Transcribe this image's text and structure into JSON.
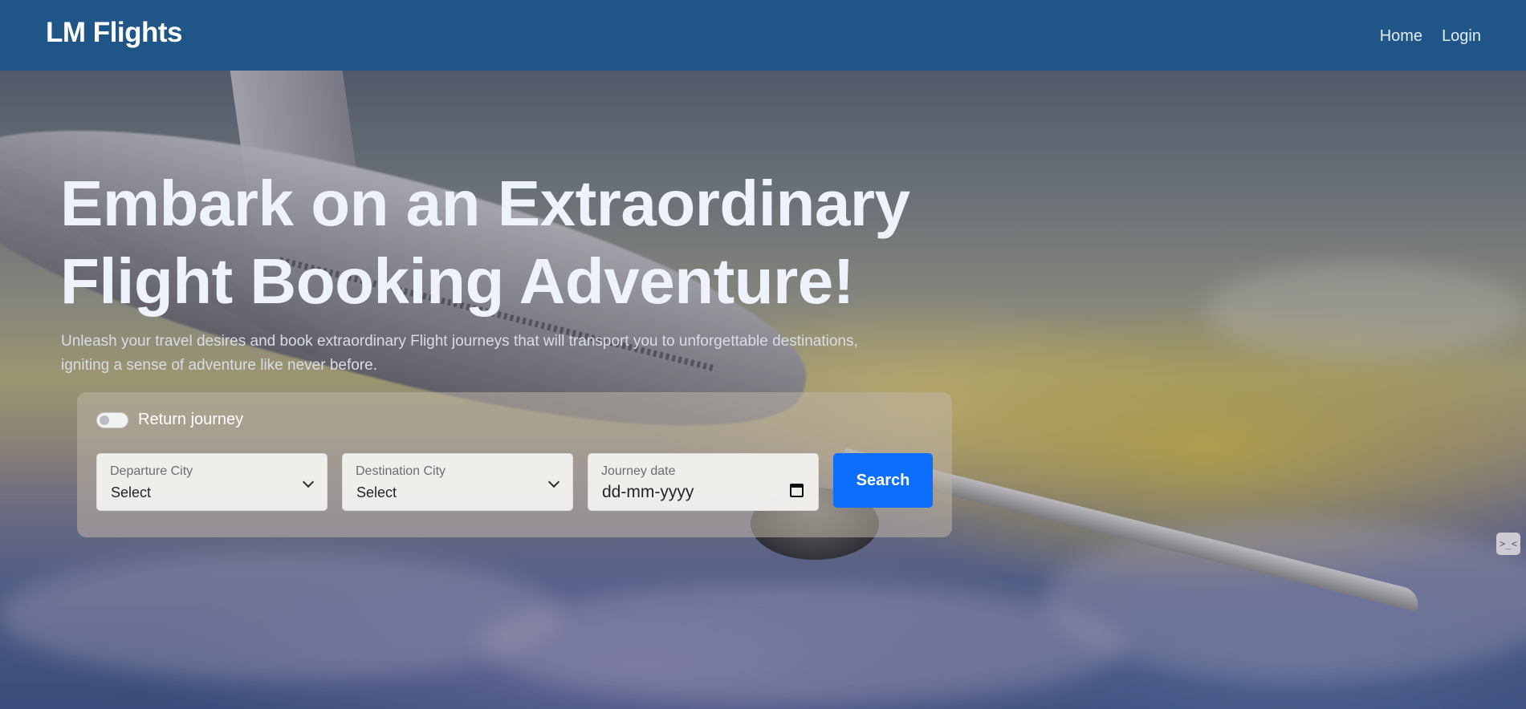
{
  "navbar": {
    "brand": "LM Flights",
    "links": [
      {
        "label": "Home"
      },
      {
        "label": "Login"
      }
    ]
  },
  "hero": {
    "title_line1": "Embark on an Extraordinary",
    "title_line2": "Flight Booking Adventure!",
    "subtitle_line1": "Unleash your travel desires and book extraordinary Flight journeys that will transport you to unforgettable destinations,",
    "subtitle_line2": "igniting a sense of adventure like never before."
  },
  "search": {
    "return_toggle": {
      "label": "Return journey",
      "checked": false
    },
    "departure": {
      "label": "Departure City",
      "value": "Select"
    },
    "destination": {
      "label": "Destination City",
      "value": "Select"
    },
    "journey_date": {
      "label": "Journey date",
      "placeholder": "dd-mm-yyyy"
    },
    "submit_label": "Search"
  },
  "side_widget": {
    "glyph": ">_<",
    "icon": "console-face-icon"
  },
  "colors": {
    "navbar": "#1f5687",
    "primary_button": "#0d6efd"
  }
}
